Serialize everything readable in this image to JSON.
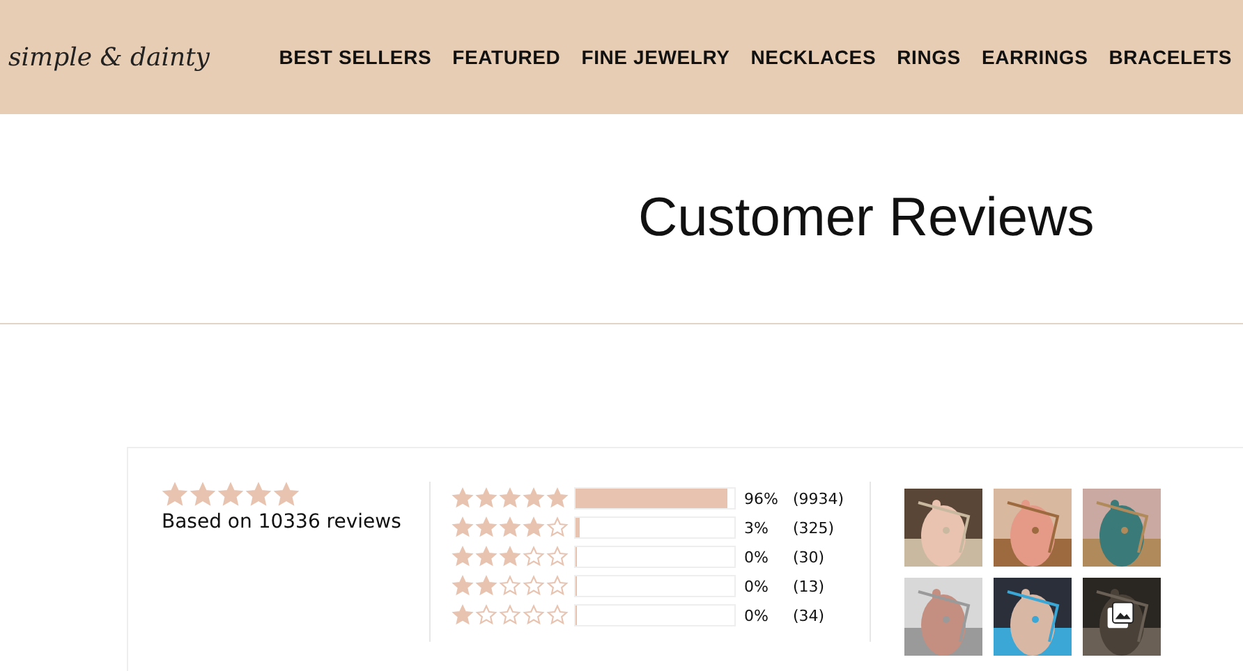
{
  "header": {
    "logo": "simple & dainty",
    "nav": [
      {
        "label": "BEST SELLERS"
      },
      {
        "label": "FEATURED"
      },
      {
        "label": "FINE JEWELRY"
      },
      {
        "label": "NECKLACES"
      },
      {
        "label": "RINGS"
      },
      {
        "label": "EARRINGS"
      },
      {
        "label": "BRACELETS"
      }
    ]
  },
  "title": "Customer Reviews",
  "summary": {
    "stars": 5,
    "text": "Based on 10336 reviews"
  },
  "breakdown": [
    {
      "stars": 5,
      "level": 0.96,
      "percent": "96%",
      "count": "(9934)"
    },
    {
      "stars": 4,
      "level": 0.03,
      "percent": "3%",
      "count": "(325)"
    },
    {
      "stars": 3,
      "level": 0,
      "percent": "0%",
      "count": "(30)"
    },
    {
      "stars": 2,
      "level": 0,
      "percent": "0%",
      "count": "(13)"
    },
    {
      "stars": 1,
      "level": 0,
      "percent": "0%",
      "count": "(34)"
    }
  ],
  "photos": [
    {
      "kind": "picture",
      "gallery": false
    },
    {
      "kind": "picture",
      "gallery": false
    },
    {
      "kind": "picture",
      "gallery": false
    },
    {
      "kind": "picture",
      "gallery": false
    },
    {
      "kind": "picture",
      "gallery": false
    },
    {
      "kind": "picture",
      "gallery": true
    }
  ]
}
